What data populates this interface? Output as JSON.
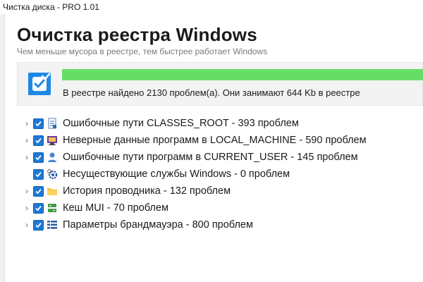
{
  "window": {
    "title": "Чистка диска - PRO 1.01"
  },
  "header": {
    "title": "Очистка реестра Windows",
    "subtitle": "Чем меньше мусора в реестре, тем быстрее работает Windows"
  },
  "summary": {
    "progress_fraction": 1.0,
    "progress_color": "#66dd66",
    "status_icon": "check-badge-icon",
    "text": "В реестре найдено 2130 проблем(а). Они занимают 644 Kb в реестре"
  },
  "tree": {
    "items": [
      {
        "label": "Ошибочные пути CLASSES_ROOT - 393 проблем",
        "checked": true,
        "icon": "file-doc-icon"
      },
      {
        "label": "Неверные данные программ в LOCAL_MACHINE - 590 проблем",
        "checked": true,
        "icon": "computer-icon"
      },
      {
        "label": "Ошибочные пути программ в CURRENT_USER - 145 проблем",
        "checked": true,
        "icon": "user-icon"
      },
      {
        "label": "Несуществующие службы Windows - 0 проблем",
        "checked": true,
        "icon": "gear-icon"
      },
      {
        "label": "История проводника - 132 проблем",
        "checked": true,
        "icon": "folder-icon"
      },
      {
        "label": "Кеш MUI - 70 проблем",
        "checked": true,
        "icon": "cache-icon"
      },
      {
        "label": "Параметры брандмауэра - 800 проблем",
        "checked": true,
        "icon": "firewall-list-icon"
      }
    ]
  },
  "colors": {
    "accent": "#1e78d4",
    "progress": "#66dd66",
    "panel_bg": "#f3f3f3"
  }
}
